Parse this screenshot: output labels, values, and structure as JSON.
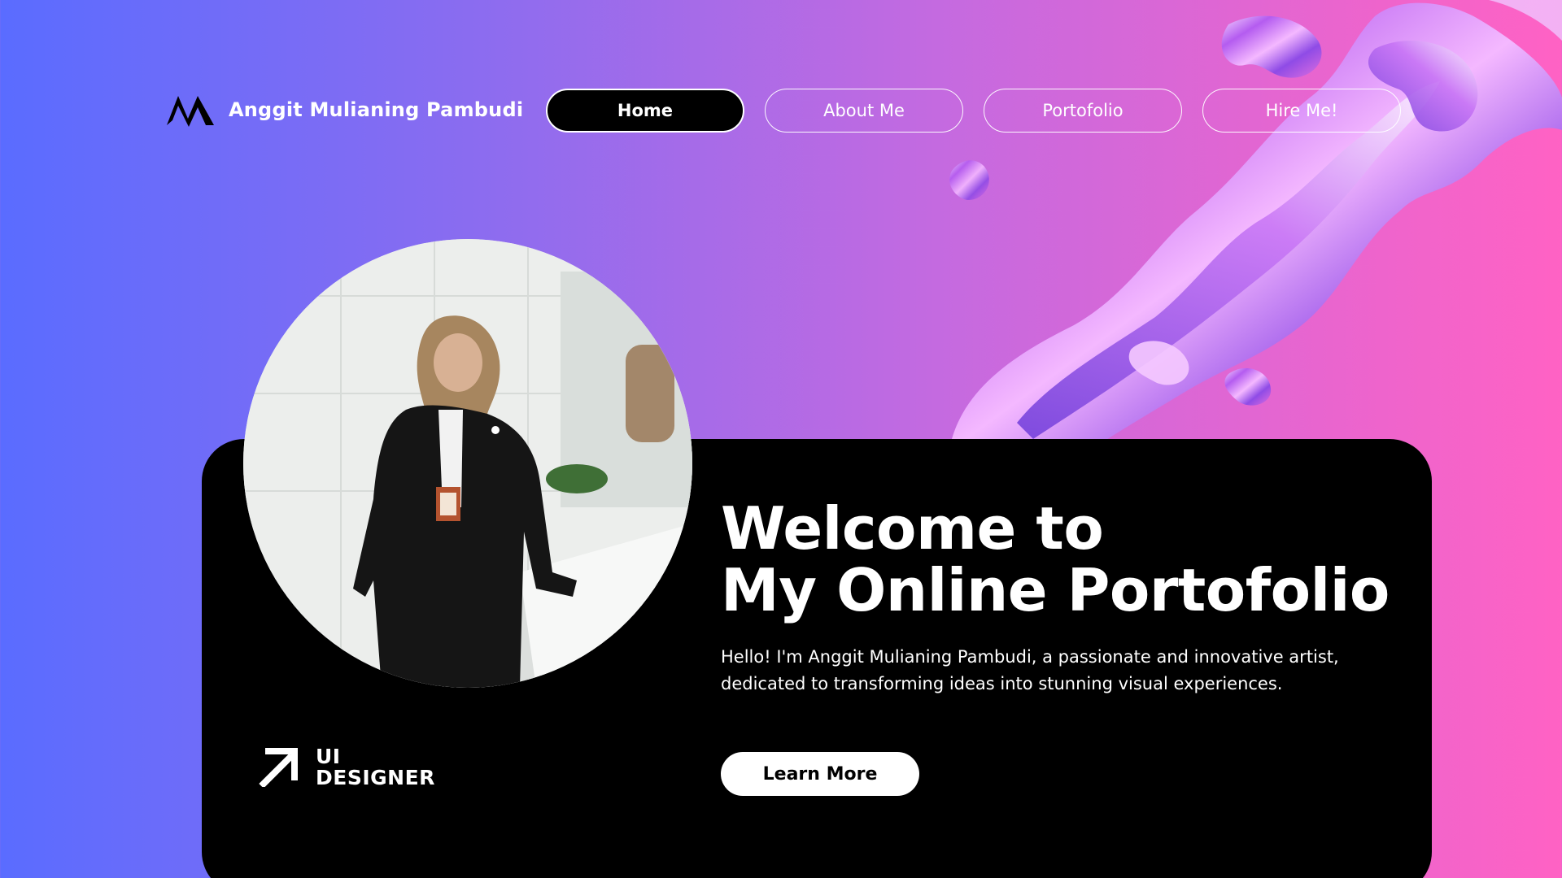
{
  "brand": {
    "name": "Anggit Mulianing Pambudi",
    "logo_icon": "mountain-m-logo-icon"
  },
  "nav": {
    "items": [
      {
        "label": "Home",
        "active": true
      },
      {
        "label": "About Me",
        "active": false
      },
      {
        "label": "Portofolio",
        "active": false
      },
      {
        "label": "Hire Me!",
        "active": false
      }
    ]
  },
  "hero": {
    "headline_line1": "Welcome to",
    "headline_line2": "My Online Portofolio",
    "intro": "Hello! I'm Anggit Mulianing Pambudi, a passionate and innovative artist, dedicated to transforming ideas into stunning visual experiences.",
    "cta_label": "Learn More",
    "role_line1": "UI",
    "role_line2": "DESIGNER",
    "role_icon": "arrow-up-right-icon",
    "profile_photo": "profile-photo"
  },
  "colors": {
    "gradient_start": "#5a6cff",
    "gradient_end": "#ff62c4",
    "card": "#000000",
    "text": "#ffffff"
  }
}
